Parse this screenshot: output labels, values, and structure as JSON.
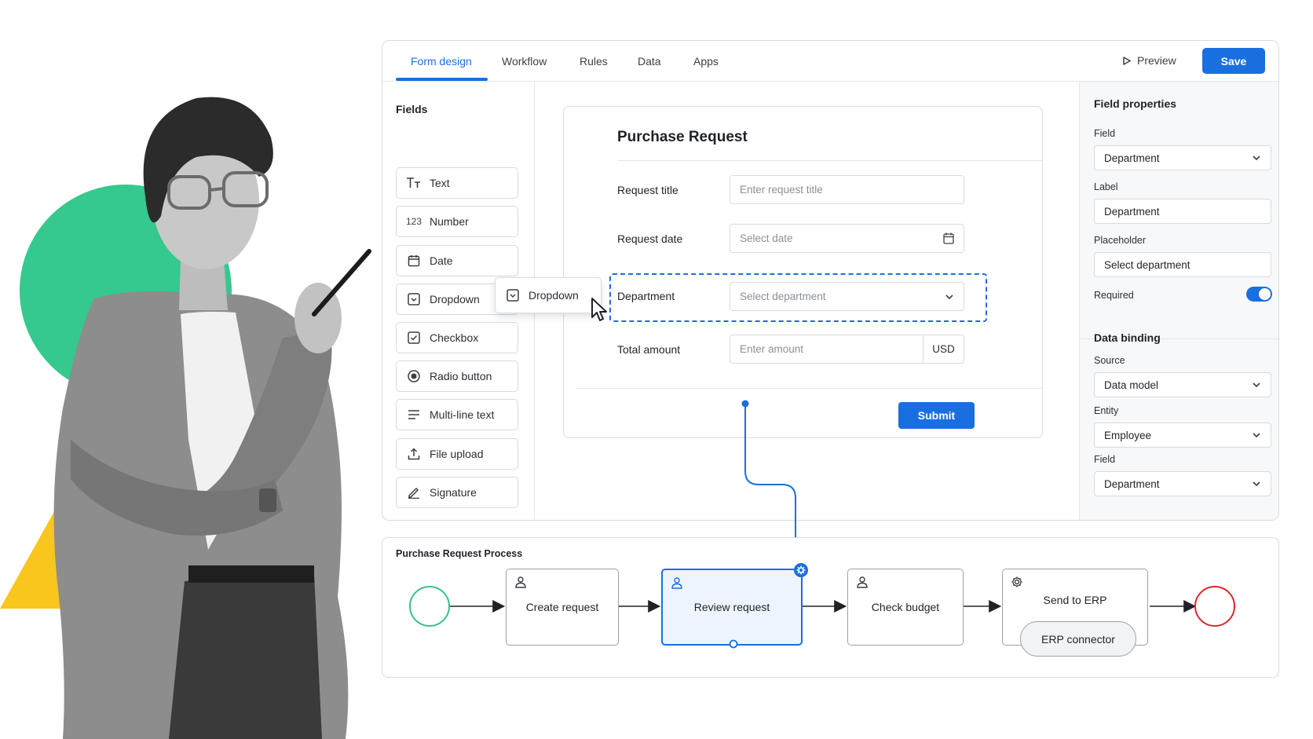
{
  "tabs": [
    {
      "label": "Form design",
      "active": true
    },
    {
      "label": "Workflow"
    },
    {
      "label": "Rules"
    },
    {
      "label": "Data"
    },
    {
      "label": "Apps"
    }
  ],
  "toolbar": {
    "preview_label": "Preview",
    "save_label": "Save"
  },
  "fields_panel": {
    "title": "Fields",
    "items": [
      {
        "label": "Text",
        "icon": "text-type-icon"
      },
      {
        "label": "Number",
        "icon": "number-icon",
        "glyph": "123"
      },
      {
        "label": "Date",
        "icon": "calendar-icon"
      },
      {
        "label": "Dropdown",
        "icon": "dropdown-icon"
      },
      {
        "label": "Checkbox",
        "icon": "checkbox-icon"
      },
      {
        "label": "Radio button",
        "icon": "radio-icon"
      },
      {
        "label": "Multi-line text",
        "icon": "multiline-icon"
      },
      {
        "label": "File upload",
        "icon": "upload-icon"
      },
      {
        "label": "Signature",
        "icon": "pen-icon"
      }
    ]
  },
  "drag_ghost": {
    "label": "Dropdown"
  },
  "form": {
    "title": "Purchase Request",
    "request_title": {
      "label": "Request title",
      "placeholder": "Enter request title"
    },
    "request_date": {
      "label": "Request date",
      "placeholder": "Select date"
    },
    "department": {
      "label": "Department",
      "placeholder": "Select department"
    },
    "total_amount": {
      "label": "Total amount",
      "placeholder": "Enter amount",
      "currency": "USD"
    },
    "submit_label": "Submit"
  },
  "properties": {
    "title": "Field properties",
    "field_label": "Field",
    "field_value": "Department",
    "label_label": "Label",
    "label_value": "Department",
    "placeholder_label": "Placeholder",
    "placeholder_value": "Select department",
    "required_label": "Required",
    "required": true,
    "binding_title": "Data binding",
    "source_label": "Source",
    "source_value": "Data model",
    "entity_label": "Entity",
    "entity_value": "Employee",
    "binding_field_label": "Field",
    "binding_field_value": "Department"
  },
  "process": {
    "title": "Purchase Request Process",
    "nodes": [
      {
        "label": "Create request",
        "icon": "user-icon"
      },
      {
        "label": "Review request",
        "icon": "user-icon",
        "selected": true
      },
      {
        "label": "Check budget",
        "icon": "user-icon"
      },
      {
        "label": "Send to ERP",
        "icon": "gear-icon"
      }
    ],
    "erp_connector": "ERP connector"
  },
  "colors": {
    "accent": "#1a6fe0",
    "start_event": "#35c28a",
    "end_event": "#e0242b",
    "deco_green": "#35c98d",
    "deco_yellow": "#f8c61c"
  }
}
